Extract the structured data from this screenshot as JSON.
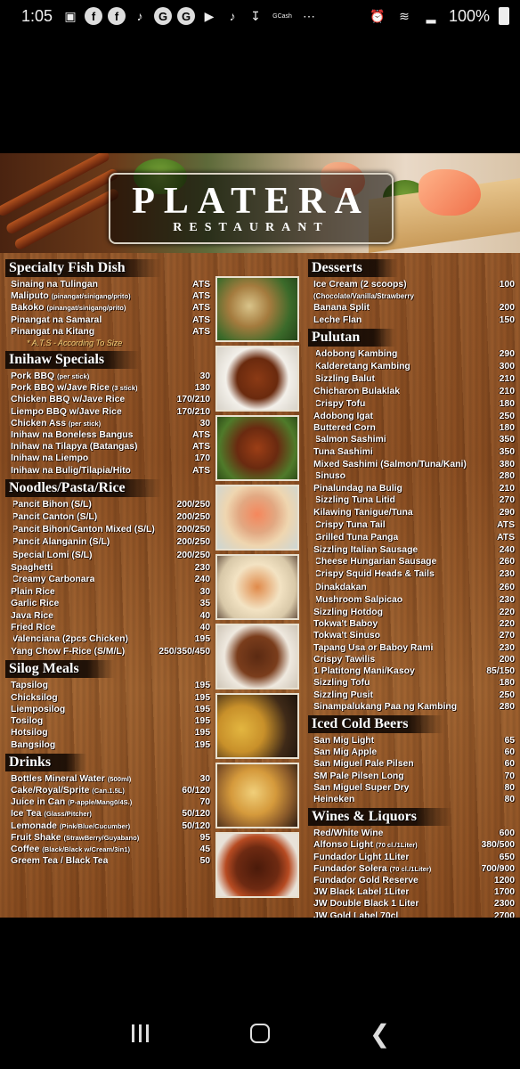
{
  "status_bar": {
    "time": "1:05",
    "carrier_tag": "GCash",
    "battery": "100%"
  },
  "logo": {
    "name": "PLATERA",
    "subtitle": "RESTAURANT"
  },
  "left": {
    "specialty": {
      "title": "Specialty Fish Dish",
      "items": [
        {
          "name": "Sinaing na Tulingan",
          "note": "",
          "price": "ATS"
        },
        {
          "name": "Maliputo",
          "note": "(pinangat/sinigang/prito)",
          "price": "ATS"
        },
        {
          "name": "Bakoko",
          "note": "(pinangat/sinigang/prito)",
          "price": "ATS"
        },
        {
          "name": "Pinangat na Samaral",
          "note": "",
          "price": "ATS"
        },
        {
          "name": "Pinangat na Kitang",
          "note": "",
          "price": "ATS"
        }
      ],
      "footnote": "* A.T.S - According To Size"
    },
    "inihaw": {
      "title": "Inihaw Specials",
      "items": [
        {
          "name": "Pork BBQ",
          "note": "(per stick)",
          "price": "30"
        },
        {
          "name": "Pork BBQ w/Jave Rice",
          "note": "(3 stick)",
          "price": "130"
        },
        {
          "name": "Chicken BBQ w/Jave Rice",
          "note": "",
          "price": "170/210"
        },
        {
          "name": "Liempo BBQ w/Jave Rice",
          "note": "",
          "price": "170/210"
        },
        {
          "name": "Chicken Ass",
          "note": "(per stick)",
          "price": "30"
        },
        {
          "name": "Inihaw na Boneless Bangus",
          "note": "",
          "price": "ATS"
        },
        {
          "name": "Inihaw na Tilapya (Batangas)",
          "note": "",
          "price": "ATS"
        },
        {
          "name": "Inihaw na Liempo",
          "note": "",
          "price": "170"
        },
        {
          "name": "Inihaw na Bulig/Tilapia/Hito",
          "note": "",
          "price": "ATS"
        }
      ]
    },
    "noodles": {
      "title": "Noodles/Pasta/Rice",
      "items": [
        {
          "name": "Pancit Bihon (S/L)",
          "price": "200/250",
          "bullet": true
        },
        {
          "name": "Pancit Canton (S/L)",
          "price": "200/250",
          "bullet": true
        },
        {
          "name": "Pancit Bihon/Canton Mixed (S/L)",
          "price": "200/250",
          "bullet": true
        },
        {
          "name": "Pancit Alanganin (S/L)",
          "price": "200/250",
          "bullet": true
        },
        {
          "name": "Special Lomi (S/L)",
          "price": "200/250",
          "bullet": true
        },
        {
          "name": "Spaghetti",
          "price": "230",
          "bullet": false
        },
        {
          "name": "Creamy Carbonara",
          "price": "240",
          "bullet": true
        },
        {
          "name": "Plain Rice",
          "price": "30",
          "bullet": false
        },
        {
          "name": "Garlic Rice",
          "price": "35",
          "bullet": false
        },
        {
          "name": "Java Rice",
          "price": "40",
          "bullet": false
        },
        {
          "name": "Fried Rice",
          "price": "40",
          "bullet": false
        },
        {
          "name": "Valenciana (2pcs Chicken)",
          "price": "195",
          "bullet": true
        },
        {
          "name": "Yang Chow F-Rice (S/M/L)",
          "price": "250/350/450",
          "bullet": false
        }
      ]
    },
    "silog": {
      "title": "Silog Meals",
      "items": [
        {
          "name": "Tapsilog",
          "price": "195"
        },
        {
          "name": "Chicksilog",
          "price": "195"
        },
        {
          "name": "Liemposilog",
          "price": "195"
        },
        {
          "name": "Tosilog",
          "price": "195"
        },
        {
          "name": "Hotsilog",
          "price": "195"
        },
        {
          "name": "Bangsilog",
          "price": "195"
        }
      ]
    },
    "drinks": {
      "title": "Drinks",
      "items": [
        {
          "name": "Bottles Mineral Water",
          "note": "(500ml)",
          "price": "30"
        },
        {
          "name": "Cake/Royal/Sprite",
          "note": "(Can.1.5L)",
          "price": "60/120"
        },
        {
          "name": "Juice in Can",
          "note": "(P-apple/Mang0/4S.)",
          "price": "70"
        },
        {
          "name": "Ice Tea",
          "note": "(Glass/Pitcher)",
          "price": "50/120"
        },
        {
          "name": "Lemonade",
          "note": "(Pink/Blue/Cucumber)",
          "price": "50/120"
        },
        {
          "name": "Fruit Shake",
          "note": "(StrawBerry/Guyabano)",
          "price": "95"
        },
        {
          "name": "Coffee",
          "note": "(Black/Black w/Cream/3in1)",
          "price": "45"
        },
        {
          "name": "Greem Tea / Black Tea",
          "note": "",
          "price": "50"
        }
      ]
    }
  },
  "right": {
    "desserts": {
      "title": "Desserts",
      "items": [
        {
          "name": "Ice Cream (2 scoops)",
          "price": "100"
        },
        {
          "name": "(Chocolate/Vanilla/Strawberry",
          "price": "",
          "small": true
        },
        {
          "name": "Banana Split",
          "price": "200"
        },
        {
          "name": "Leche Flan",
          "price": "150"
        }
      ]
    },
    "pulutan": {
      "title": "Pulutan",
      "items": [
        {
          "name": "Adobong Kambing",
          "price": "290",
          "bullet": true
        },
        {
          "name": "Kalderetang Kambing",
          "price": "300",
          "bullet": true
        },
        {
          "name": "Sizzling Balut",
          "price": "210",
          "bullet": true
        },
        {
          "name": "Chicharon Bulaklak",
          "price": "210",
          "bullet": false
        },
        {
          "name": "Crispy Tofu",
          "price": "180",
          "bullet": true
        },
        {
          "name": "Adobong Igat",
          "price": "250",
          "bullet": false
        },
        {
          "name": "Buttered Corn",
          "price": "180",
          "bullet": false
        },
        {
          "name": "Salmon Sashimi",
          "price": "350",
          "bullet": true
        },
        {
          "name": "Tuna Sashimi",
          "price": "350",
          "bullet": false
        },
        {
          "name": "Mixed Sashimi (Salmon/Tuna/Kani)",
          "price": "380",
          "bullet": false
        },
        {
          "name": "Sinuso",
          "price": "280",
          "bullet": true
        },
        {
          "name": "Pinalundag na Bulig",
          "price": "210",
          "bullet": false
        },
        {
          "name": "Sizzling Tuna Litid",
          "price": "270",
          "bullet": true
        },
        {
          "name": "Kilawing Tanigue/Tuna",
          "price": "290",
          "bullet": false
        },
        {
          "name": "Crispy Tuna Tail",
          "price": "ATS",
          "bullet": true
        },
        {
          "name": "Grilled Tuna Panga",
          "price": "ATS",
          "bullet": true
        },
        {
          "name": "Sizzling Italian Sausage",
          "price": "240",
          "bullet": false
        },
        {
          "name": "Cheese Hungarian Sausage",
          "price": "260",
          "bullet": true
        },
        {
          "name": "Crispy Squid Heads & Tails",
          "price": "230",
          "bullet": true
        },
        {
          "name": "Dinakdakan",
          "price": "260",
          "bullet": true
        },
        {
          "name": "Mushroom Salpicao",
          "price": "230",
          "bullet": true
        },
        {
          "name": "Sizzling Hotdog",
          "price": "220",
          "bullet": false
        },
        {
          "name": "Tokwa't Baboy",
          "price": "220",
          "bullet": false
        },
        {
          "name": "Tokwa't Sinuso",
          "price": "270",
          "bullet": false
        },
        {
          "name": "Tapang Usa or Baboy Rami",
          "price": "230",
          "bullet": false
        },
        {
          "name": "Crispy Tawilis",
          "price": "200",
          "bullet": false
        },
        {
          "name": "1 Platitong Mani/Kasoy",
          "price": "85/150",
          "bullet": false
        },
        {
          "name": "Sizzling Tofu",
          "price": "180",
          "bullet": false
        },
        {
          "name": "Sizzling Pusit",
          "price": "250",
          "bullet": false
        },
        {
          "name": "Sinampalukang Paa ng Kambing",
          "price": "280",
          "bullet": false
        }
      ]
    },
    "beers": {
      "title": "Iced Cold Beers",
      "items": [
        {
          "name": "San Mig Light",
          "price": "65"
        },
        {
          "name": "San Mig Apple",
          "price": "60"
        },
        {
          "name": "San Miguel Pale Pilsen",
          "price": "60"
        },
        {
          "name": "SM Pale Pilsen Long",
          "price": "70"
        },
        {
          "name": "San Miguel Super Dry",
          "price": "80"
        },
        {
          "name": "Heineken",
          "price": "80"
        }
      ]
    },
    "wines": {
      "title": "Wines & Liquors",
      "items": [
        {
          "name": "Red/White Wine",
          "note": "",
          "price": "600"
        },
        {
          "name": "Alfonso Light",
          "note": "(70 cl./1Liter)",
          "price": "380/500"
        },
        {
          "name": "Fundador Light 1Liter",
          "note": "",
          "price": "650"
        },
        {
          "name": "Fundador Solera",
          "note": "(70 cl./1Liter)",
          "price": "700/900"
        },
        {
          "name": "Fundador Gold Reserve",
          "note": "",
          "price": "1200"
        },
        {
          "name": "JW Black Label 1Liter",
          "note": "",
          "price": "1700"
        },
        {
          "name": "JW Double Black 1 Liter",
          "note": "",
          "price": "2300"
        },
        {
          "name": "JW Gold Label 70cl",
          "note": "",
          "price": "2700"
        }
      ]
    }
  }
}
